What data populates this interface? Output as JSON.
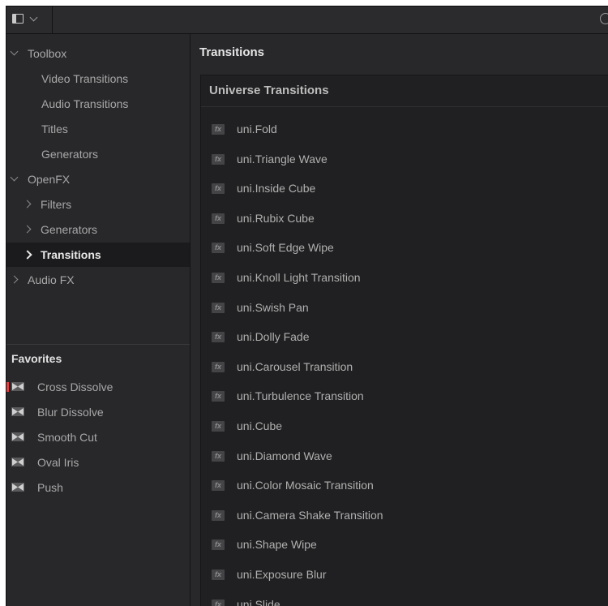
{
  "sidebar": {
    "tree": [
      {
        "label": "Toolbox",
        "arrow": "down",
        "level": 0
      },
      {
        "label": "Video Transitions",
        "arrow": "none",
        "level": 1
      },
      {
        "label": "Audio Transitions",
        "arrow": "none",
        "level": 1
      },
      {
        "label": "Titles",
        "arrow": "none",
        "level": 1
      },
      {
        "label": "Generators",
        "arrow": "none",
        "level": 1
      },
      {
        "label": "OpenFX",
        "arrow": "down",
        "level": 0
      },
      {
        "label": "Filters",
        "arrow": "right",
        "level": 1
      },
      {
        "label": "Generators",
        "arrow": "right",
        "level": 1
      },
      {
        "label": "Transitions",
        "arrow": "right",
        "level": 1,
        "selected": true
      },
      {
        "label": "Audio FX",
        "arrow": "right",
        "level": 0
      }
    ],
    "favorites_title": "Favorites",
    "favorites": [
      {
        "label": "Cross Dissolve",
        "marked": true
      },
      {
        "label": "Blur Dissolve"
      },
      {
        "label": "Smooth Cut"
      },
      {
        "label": "Oval Iris"
      },
      {
        "label": "Push"
      }
    ]
  },
  "main": {
    "title": "Transitions",
    "group_title": "Universe Transitions",
    "icon_text": "fx",
    "items": [
      "uni.Fold",
      "uni.Triangle Wave",
      "uni.Inside Cube",
      "uni.Rubix Cube",
      "uni.Soft Edge Wipe",
      "uni.Knoll Light Transition",
      "uni.Swish Pan",
      "uni.Dolly Fade",
      "uni.Carousel Transition",
      "uni.Turbulence Transition",
      "uni.Cube",
      "uni.Diamond Wave",
      "uni.Color Mosaic Transition",
      "uni.Camera Shake Transition",
      "uni.Shape Wipe",
      "uni.Exposure Blur",
      "uni.Slide"
    ]
  },
  "colors": {
    "background": "#28282b",
    "selected_row": "#1b1b1d",
    "favorite_marker": "#e04040"
  }
}
